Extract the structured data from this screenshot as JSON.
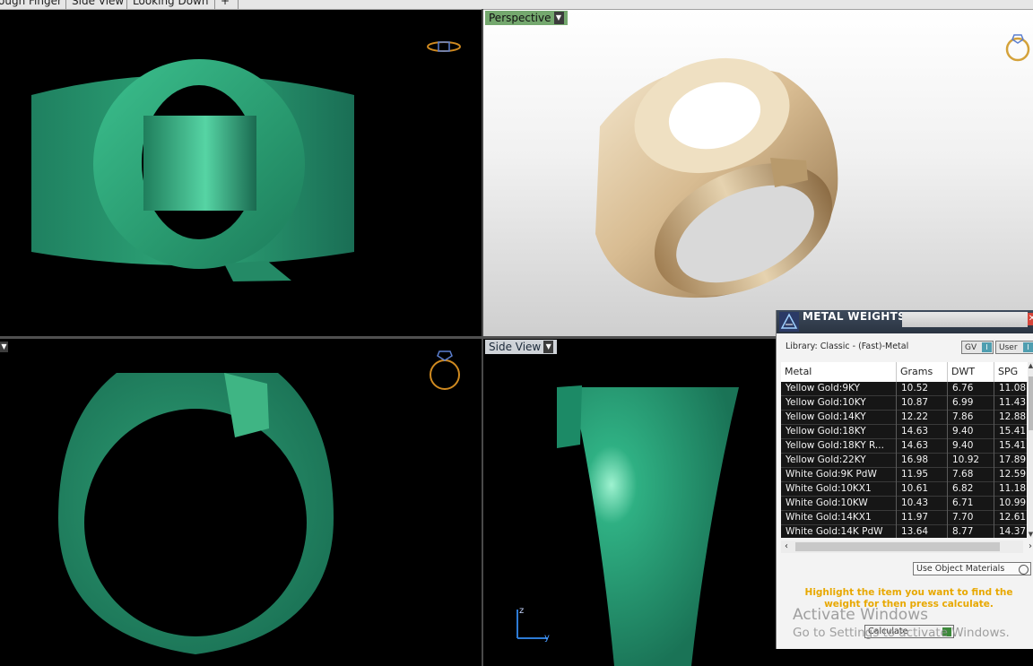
{
  "tabs": [
    "ough Finger",
    "Side View",
    "Looking Down",
    "+"
  ],
  "viewports": {
    "perspective_label": "Perspective",
    "side_label": "Side View"
  },
  "metal_panel": {
    "title": "METAL WEIGHTS",
    "library": "Library: Classic - (Fast)-Metal",
    "gv_label": "GV",
    "user_label": "User",
    "toggle_glyph": "I",
    "columns": [
      "Metal",
      "Grams",
      "DWT",
      "SPG"
    ],
    "rows": [
      [
        "Yellow Gold:9KY",
        "10.52",
        "6.76",
        "11.08"
      ],
      [
        "Yellow Gold:10KY",
        "10.87",
        "6.99",
        "11.43"
      ],
      [
        "Yellow Gold:14KY",
        "12.22",
        "7.86",
        "12.88"
      ],
      [
        "Yellow Gold:18KY",
        "14.63",
        "9.40",
        "15.41"
      ],
      [
        "Yellow Gold:18KY R...",
        "14.63",
        "9.40",
        "15.41"
      ],
      [
        "Yellow Gold:22KY",
        "16.98",
        "10.92",
        "17.89"
      ],
      [
        "White Gold:9K PdW",
        "11.95",
        "7.68",
        "12.59"
      ],
      [
        "White Gold:10KX1",
        "10.61",
        "6.82",
        "11.18"
      ],
      [
        "White Gold:10KW",
        "10.43",
        "6.71",
        "10.99"
      ],
      [
        "White Gold:14KX1",
        "11.97",
        "7.70",
        "12.61"
      ],
      [
        "White Gold:14K PdW",
        "13.64",
        "8.77",
        "14.37"
      ]
    ],
    "use_object_materials": "Use Object Materials",
    "hint": "Highlight the item you want to find the weight for then press calculate.",
    "calculate_label": "Calculate"
  },
  "watermark": {
    "line1": "Activate Windows",
    "line2": "Go to Settings to activate Windows."
  },
  "axes_labels": {
    "z": "z",
    "y": "y"
  },
  "colors": {
    "viewport_bg": "#000000",
    "ring_green": "#2e9a72",
    "ring_gold": "#d8c09a",
    "hint_yellow": "#e8a800",
    "perspective_tab": "#74a86e"
  }
}
